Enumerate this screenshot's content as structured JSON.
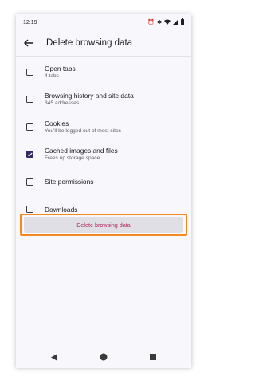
{
  "status": {
    "time": "12:19",
    "icons": [
      "alarm-icon",
      "bluetooth-icon",
      "wifi-icon",
      "signal-icon",
      "battery-icon"
    ]
  },
  "appbar": {
    "back_icon": "arrow-back-icon",
    "title": "Delete browsing data"
  },
  "options": [
    {
      "label": "Open tabs",
      "sub": "4 tabs",
      "checked": false
    },
    {
      "label": "Browsing history and site data",
      "sub": "345 addresses",
      "checked": false
    },
    {
      "label": "Cookies",
      "sub": "You'll be logged out of most sites",
      "checked": false
    },
    {
      "label": "Cached images and files",
      "sub": "Frees up storage space",
      "checked": true
    },
    {
      "label": "Site permissions",
      "sub": "",
      "checked": false
    },
    {
      "label": "Downloads",
      "sub": "",
      "checked": false
    }
  ],
  "delete_button": {
    "label": "Delete browsing data"
  },
  "navbar": {
    "icons": [
      "back-triangle-icon",
      "home-circle-icon",
      "recents-square-icon"
    ]
  },
  "colors": {
    "accent": "#312a65",
    "delete_text": "#b3265c",
    "highlight": "#f28a21"
  }
}
